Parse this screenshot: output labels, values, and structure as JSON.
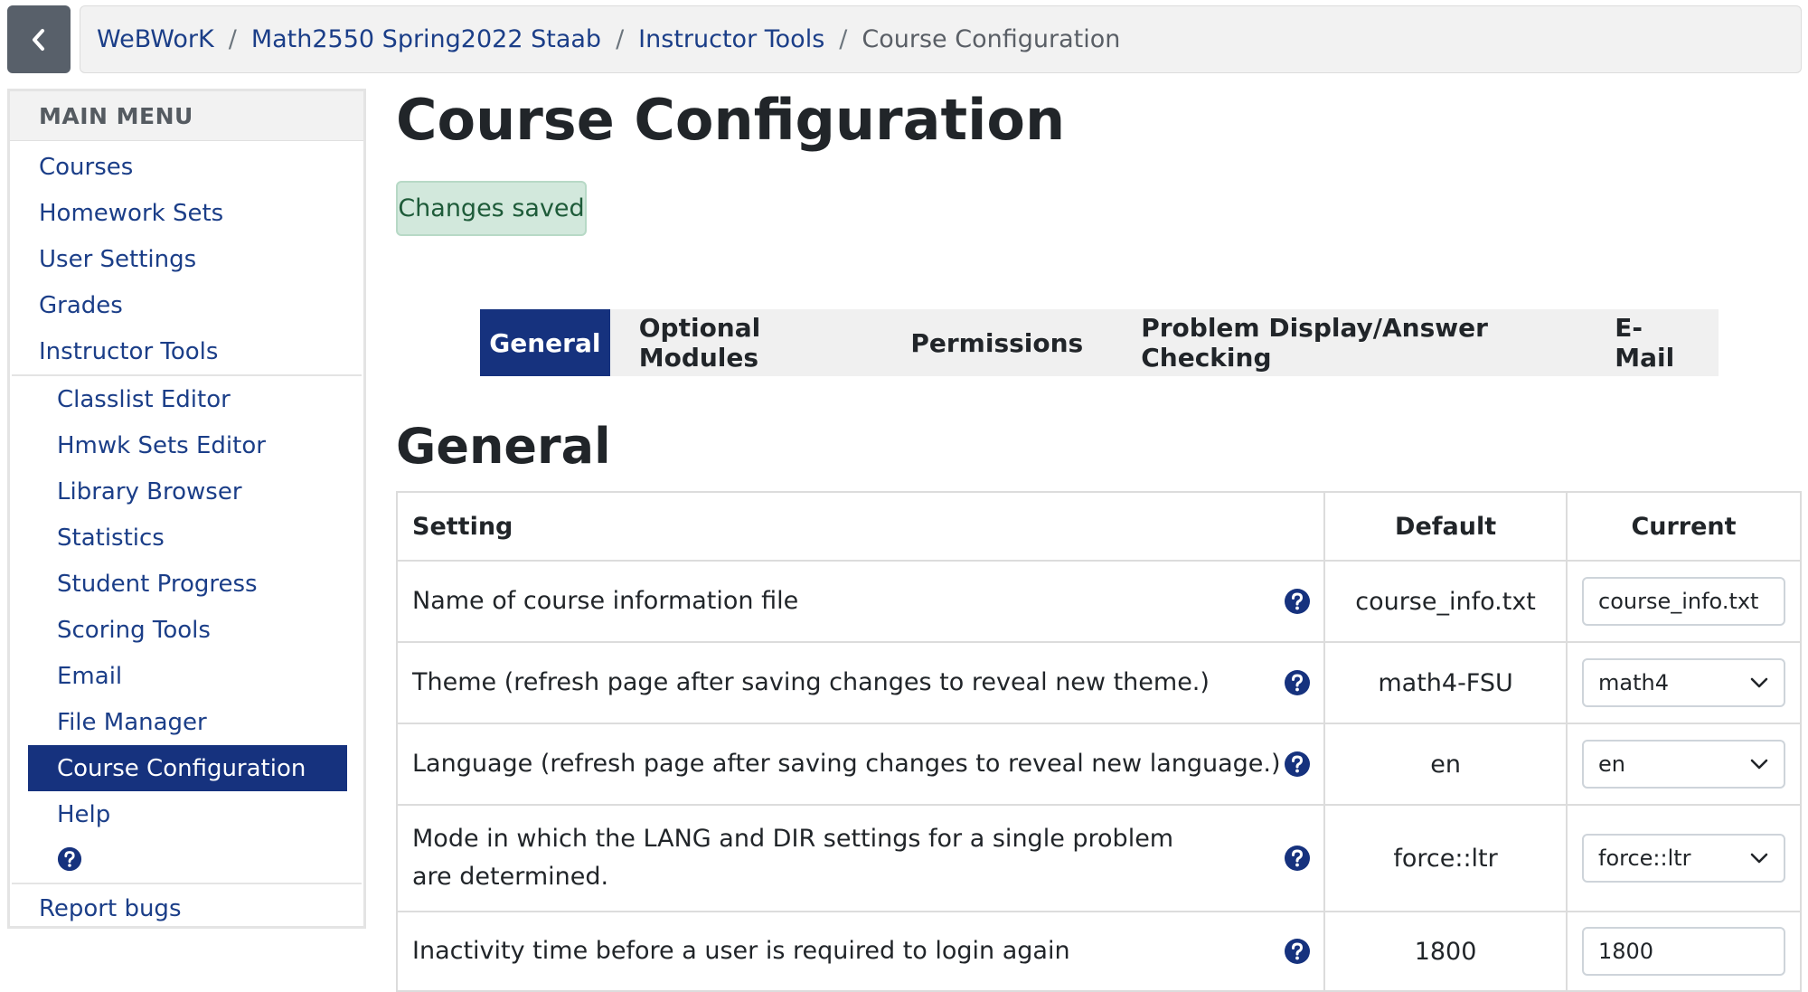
{
  "breadcrumb": {
    "items": [
      "WeBWorK",
      "Math2550 Spring2022 Staab",
      "Instructor Tools"
    ],
    "current": "Course Configuration",
    "separator": "/"
  },
  "sidebar": {
    "title": "MAIN MENU",
    "items": [
      "Courses",
      "Homework Sets",
      "User Settings",
      "Grades",
      "Instructor Tools"
    ],
    "subitems": [
      "Classlist Editor",
      "Hmwk Sets Editor",
      "Library Browser",
      "Statistics",
      "Student Progress",
      "Scoring Tools",
      "Email",
      "File Manager",
      "Course Configuration",
      "Help"
    ],
    "active": "Course Configuration",
    "footer": "Report bugs"
  },
  "page": {
    "title": "Course Configuration",
    "alert": "Changes saved",
    "section_title": "General"
  },
  "tabs": [
    "General",
    "Optional Modules",
    "Permissions",
    "Problem Display/Answer Checking",
    "E-Mail"
  ],
  "table": {
    "headers": [
      "Setting",
      "Default",
      "Current"
    ],
    "rows": [
      {
        "setting": "Name of course information file",
        "default": "course_info.txt",
        "current": "course_info.txt",
        "control": "text"
      },
      {
        "setting": "Theme (refresh page after saving changes to reveal new theme.)",
        "default": "math4-FSU",
        "current": "math4",
        "control": "select"
      },
      {
        "setting": "Language (refresh page after saving changes to reveal new language.)",
        "default": "en",
        "current": "en",
        "control": "select"
      },
      {
        "setting": "Mode in which the LANG and DIR settings for a single problem are determined.",
        "default": "force::ltr",
        "current": "force::ltr",
        "control": "select"
      },
      {
        "setting": "Inactivity time before a user is required to login again",
        "default": "1800",
        "current": "1800",
        "control": "text"
      }
    ]
  },
  "colors": {
    "brand": "#16327e",
    "link": "#1b3e88",
    "alert_bg": "#d2e8dc",
    "alert_text": "#1e5b39"
  },
  "icons": {
    "back": "chevron-left-icon",
    "help": "question-circle-icon",
    "dropdown": "chevron-down-icon"
  }
}
